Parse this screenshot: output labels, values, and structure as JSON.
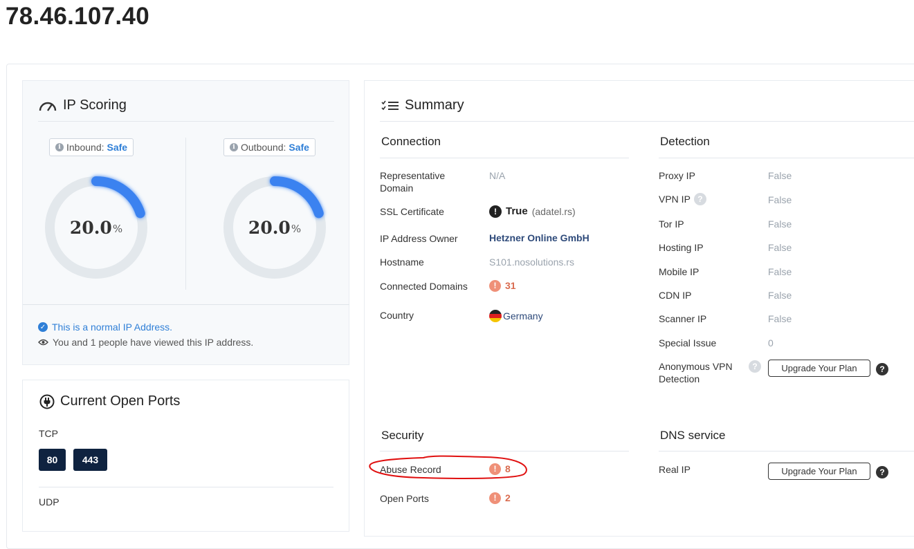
{
  "ip_address": "78.46.107.40",
  "scoring": {
    "title": "IP Scoring",
    "inbound": {
      "label": "Inbound:",
      "verdict": "Safe",
      "score": 20.0,
      "score_text": "20.0",
      "unit": "%"
    },
    "outbound": {
      "label": "Outbound:",
      "verdict": "Safe",
      "score": 20.0,
      "score_text": "20.0",
      "unit": "%"
    },
    "normal_note": "This is a normal IP Address.",
    "views_note": "You and 1 people have viewed this IP address."
  },
  "ports": {
    "title": "Current Open Ports",
    "tcp_label": "TCP",
    "tcp": [
      "80",
      "443"
    ],
    "udp_label": "UDP"
  },
  "summary": {
    "title": "Summary",
    "connection": {
      "title": "Connection",
      "rows": [
        {
          "label": "Representative Domain",
          "value": "N/A"
        },
        {
          "label": "SSL Certificate",
          "value": "True",
          "detail": "(adatel.rs)"
        },
        {
          "label": "IP Address Owner",
          "value": "Hetzner Online GmbH"
        },
        {
          "label": "Hostname",
          "value": "S101.nosolutions.rs"
        },
        {
          "label": "Connected Domains",
          "value": "31"
        },
        {
          "label": "Country",
          "value": "Germany"
        }
      ]
    },
    "detection": {
      "title": "Detection",
      "rows": [
        {
          "label": "Proxy IP",
          "value": "False"
        },
        {
          "label": "VPN IP",
          "value": "False"
        },
        {
          "label": "Tor IP",
          "value": "False"
        },
        {
          "label": "Hosting IP",
          "value": "False"
        },
        {
          "label": "Mobile IP",
          "value": "False"
        },
        {
          "label": "CDN IP",
          "value": "False"
        },
        {
          "label": "Scanner IP",
          "value": "False"
        },
        {
          "label": "Special Issue",
          "value": "0"
        },
        {
          "label": "Anonymous VPN Detection",
          "value": "Upgrade Your Plan"
        }
      ]
    },
    "security": {
      "title": "Security",
      "rows": [
        {
          "label": "Abuse Record",
          "value": "8"
        },
        {
          "label": "Open Ports",
          "value": "2"
        }
      ]
    },
    "dns": {
      "title": "DNS service",
      "rows": [
        {
          "label": "Real IP",
          "value": "Upgrade Your Plan"
        }
      ]
    }
  },
  "colors": {
    "accent_blue": "#3b82f0",
    "gauge_track": "#e3e8ec",
    "port_chip": "#0f2340",
    "alert": "#d96b4f",
    "annotation_red": "#e01010"
  }
}
